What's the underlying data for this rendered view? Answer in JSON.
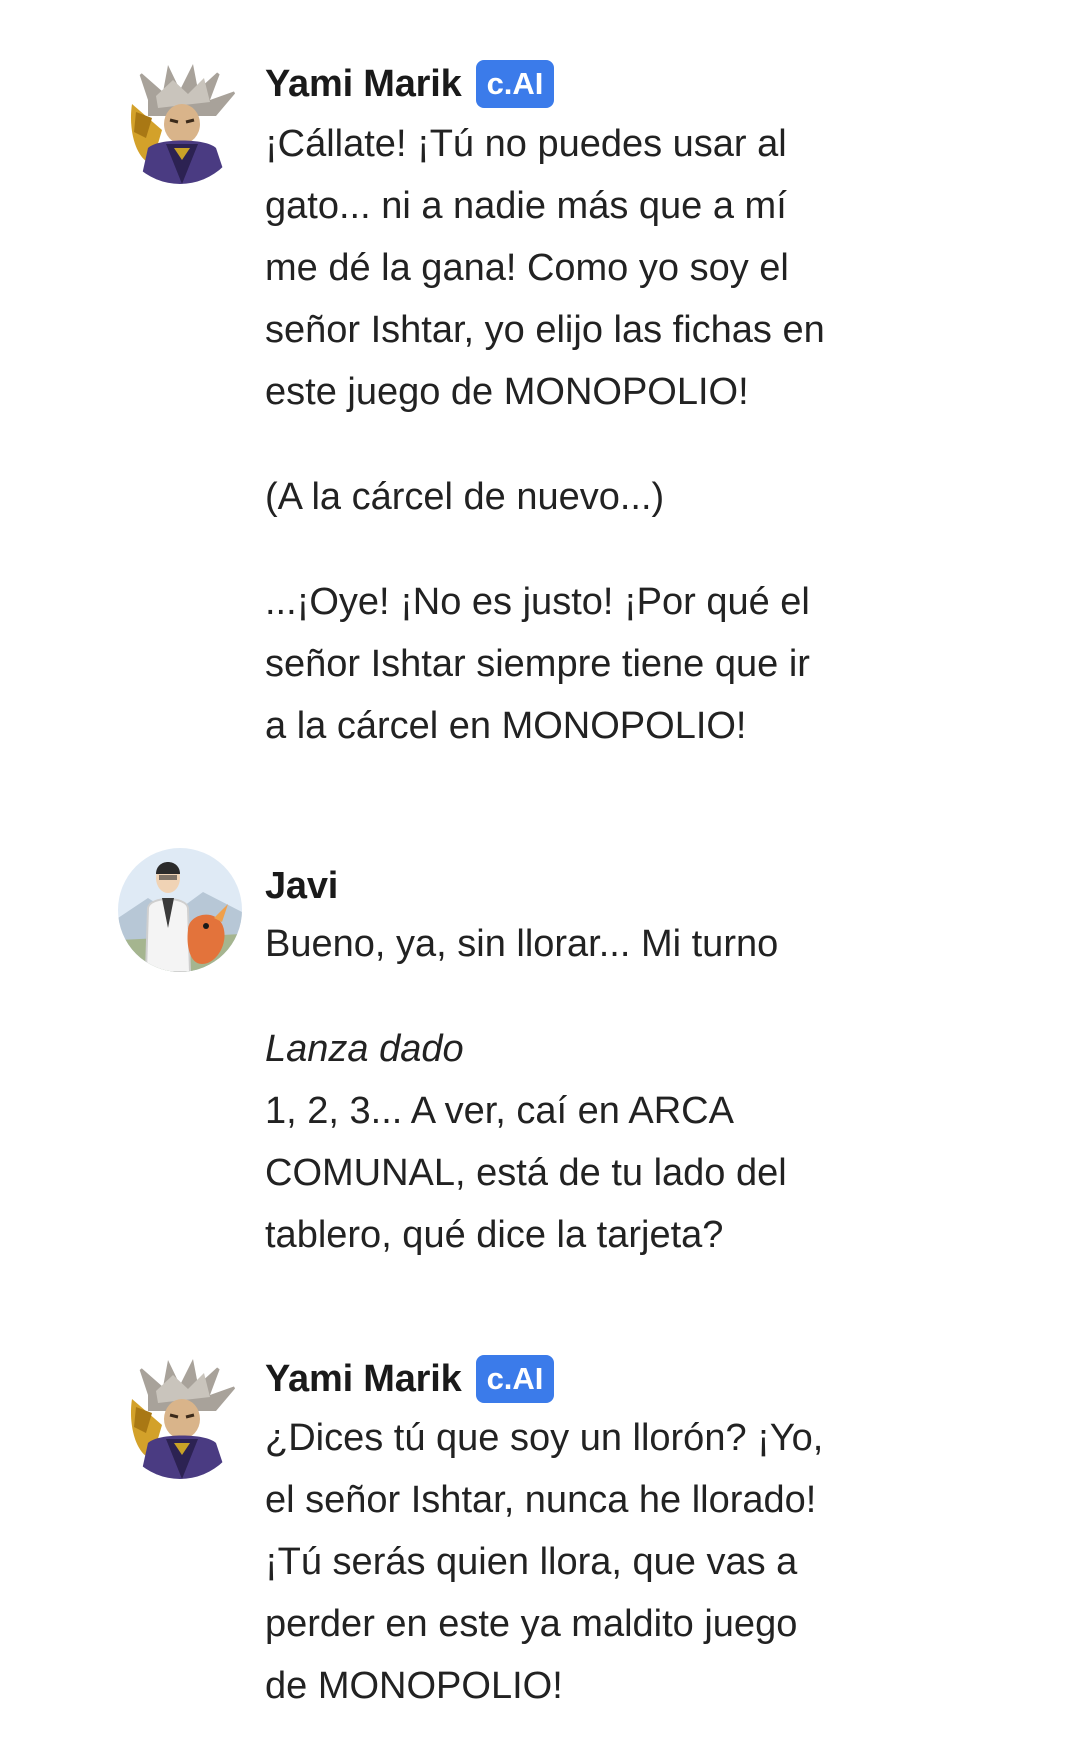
{
  "theme": {
    "badge_color": "#3b7bea",
    "text_color": "#222222",
    "background": "#ffffff"
  },
  "messages": [
    {
      "author": "Yami Marik",
      "badge": "c.AI",
      "avatar_icon": "yami-marik-avatar",
      "paragraphs": [
        [
          "¡Cállate! ¡Tú no puedes usar al",
          "gato... ni a nadie más que a mí",
          "me dé la gana! Como yo soy el",
          "señor Ishtar, yo elijo las fichas en",
          "este juego de MONOPOLIO!"
        ],
        [
          "(A la cárcel de nuevo...)"
        ],
        [
          "...¡Oye! ¡No es justo! ¡Por qué el",
          "señor Ishtar siempre tiene que ir",
          "a la cárcel en MONOPOLIO!"
        ]
      ]
    },
    {
      "author": "Javi",
      "badge": "",
      "avatar_icon": "javi-avatar",
      "paragraphs": [
        [
          "Bueno, ya, sin llorar... Mi turno"
        ],
        [
          "Lanza dado",
          "1, 2, 3... A ver, caí en ARCA",
          "COMUNAL, está de tu lado del",
          "tablero, qué dice la tarjeta?"
        ]
      ]
    },
    {
      "author": "Yami Marik",
      "badge": "c.AI",
      "avatar_icon": "yami-marik-avatar",
      "paragraphs": [
        [
          "¿Dices tú que soy un llorón? ¡Yo,",
          "el señor Ishtar, nunca he llorado!",
          "¡Tú serás quien llora, que vas a",
          "perder en este ya maldito juego",
          "de MONOPOLIO!"
        ]
      ]
    }
  ]
}
